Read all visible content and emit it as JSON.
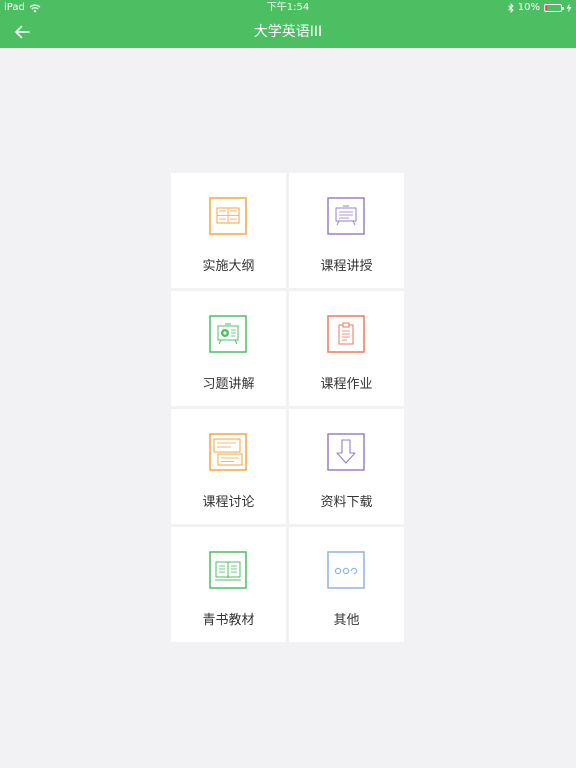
{
  "status_bar": {
    "device": "iPad",
    "time": "下午1:54",
    "battery": "10%",
    "battery_level": 0.1
  },
  "nav": {
    "title": "大学英语III",
    "back_icon": "arrow-left-icon"
  },
  "colors": {
    "nav_bg": "#4cbf63",
    "page_bg": "#f2f2f4",
    "orange": "#f5a540",
    "purple": "#9a7fc7",
    "green": "#4cbf63",
    "red": "#ee7a55",
    "blue": "#8fb2e6"
  },
  "menu": {
    "items": [
      {
        "label": "实施大纲",
        "icon": "syllabus-icon"
      },
      {
        "label": "课程讲授",
        "icon": "lecture-icon"
      },
      {
        "label": "习题讲解",
        "icon": "exercise-explanation-icon"
      },
      {
        "label": "课程作业",
        "icon": "homework-icon"
      },
      {
        "label": "课程讨论",
        "icon": "discussion-icon"
      },
      {
        "label": "资料下载",
        "icon": "download-icon"
      },
      {
        "label": "青书教材",
        "icon": "textbook-icon"
      },
      {
        "label": "其他",
        "icon": "more-icon"
      }
    ]
  }
}
